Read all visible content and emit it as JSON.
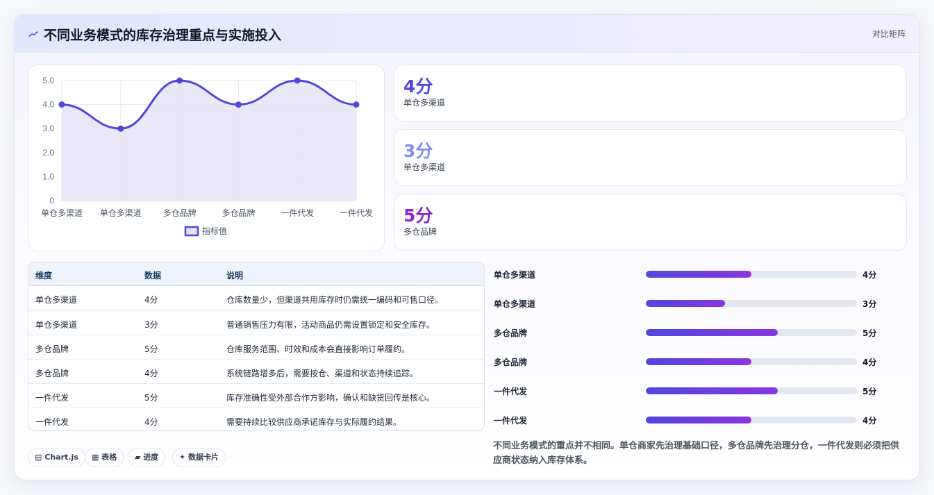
{
  "header": {
    "title": "不同业务模式的库存治理重点与实施投入",
    "tag": "对比矩阵"
  },
  "chart_data": {
    "type": "line",
    "categories": [
      "单仓多渠道",
      "单仓多渠道",
      "多仓品牌",
      "多仓品牌",
      "一件代发",
      "一件代发"
    ],
    "series": [
      {
        "name": "指标值",
        "values": [
          4,
          3,
          5,
          4,
          5,
          4
        ]
      }
    ],
    "ylim": [
      0,
      5
    ],
    "yticks": [
      "5.0",
      "4.0",
      "3.0",
      "2.0",
      "1.0",
      "0"
    ],
    "grid": true,
    "legend": "bottom",
    "colors": {
      "line": "#5046d8",
      "fill": "#e6e3f8"
    }
  },
  "stats": [
    {
      "value": "4分",
      "label": "单仓多渠道",
      "color": "#4f46e5"
    },
    {
      "value": "3分",
      "label": "单仓多渠道",
      "color": "#818cf8"
    },
    {
      "value": "5分",
      "label": "多仓品牌",
      "color": "#8b26d9"
    }
  ],
  "table": {
    "headers": [
      "维度",
      "数据",
      "说明"
    ],
    "rows": [
      [
        "单仓多渠道",
        "4分",
        "仓库数量少，但渠道共用库存时仍需统一编码和可售口径。"
      ],
      [
        "单仓多渠道",
        "3分",
        "普通销售压力有限，活动商品仍需设置锁定和安全库存。"
      ],
      [
        "多仓品牌",
        "5分",
        "仓库服务范围、时效和成本会直接影响订单履约。"
      ],
      [
        "多仓品牌",
        "4分",
        "系统链路增多后，需要按仓、渠道和状态持续追踪。"
      ],
      [
        "一件代发",
        "5分",
        "库存准确性受外部合作方影响，确认和缺货回传是核心。"
      ],
      [
        "一件代发",
        "4分",
        "需要持续比较供应商承诺库存与实际履约结果。"
      ]
    ]
  },
  "pills": [
    {
      "icon": "▤",
      "label": "Chart.js"
    },
    {
      "icon": "▦",
      "label": "表格"
    },
    {
      "icon": "▰",
      "label": "进度"
    },
    {
      "icon": "✦",
      "label": "数据卡片"
    }
  ],
  "bars": [
    {
      "label": "单仓多渠道",
      "value": 4,
      "display": "4分"
    },
    {
      "label": "单仓多渠道",
      "value": 3,
      "display": "3分"
    },
    {
      "label": "多仓品牌",
      "value": 5,
      "display": "5分"
    },
    {
      "label": "多仓品牌",
      "value": 4,
      "display": "4分"
    },
    {
      "label": "一件代发",
      "value": 5,
      "display": "5分"
    },
    {
      "label": "一件代发",
      "value": 4,
      "display": "4分"
    }
  ],
  "bar_max": 8,
  "summary": "不同业务模式的重点并不相同。单仓商家先治理基础口径，多仓品牌先治理分仓，一件代发则必须把供应商状态纳入库存体系。"
}
